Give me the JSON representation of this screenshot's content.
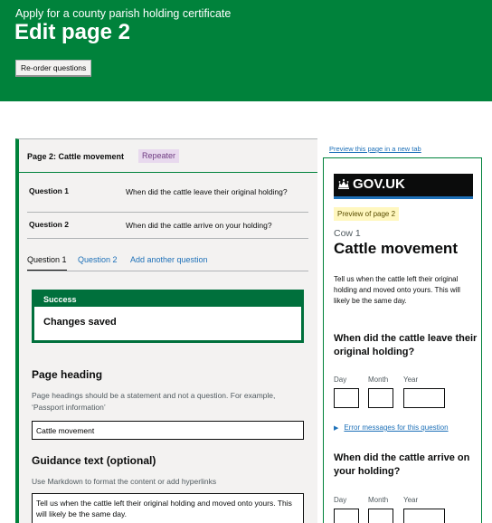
{
  "header": {
    "service_name": "Apply for a county parish holding certificate",
    "page_title": "Edit page 2",
    "reorder_label": "Re-order questions"
  },
  "editor": {
    "page_title": "Page 2: Cattle movement",
    "tag": "Repeater",
    "questions": [
      {
        "num": "Question 1",
        "text": "When did the cattle leave their original holding?"
      },
      {
        "num": "Question 2",
        "text": "When did the cattle arrive on your holding?"
      }
    ],
    "tabs": [
      "Question 1",
      "Question 2",
      "Add another question"
    ],
    "success": {
      "heading": "Success",
      "body": "Changes saved"
    },
    "page_heading": {
      "label": "Page heading",
      "hint": "Page headings should be a statement and not a question. For example, ‘Passport information’",
      "value": "Cattle movement"
    },
    "guidance": {
      "label": "Guidance text (optional)",
      "hint": "Use Markdown to format the content or add hyperlinks",
      "value": "Tell us when the cattle left their original holding and moved onto yours. This will likely be the same day."
    }
  },
  "preview": {
    "link": "Preview this page in a new tab",
    "brand": "GOV.UK",
    "tag": "Preview of page 2",
    "caption": "Cow 1",
    "heading": "Cattle movement",
    "body": "Tell us when the cattle left their original holding and moved onto yours. This will likely be the same day.",
    "q1": "When did the cattle leave their original holding?",
    "q2": "When did the cattle arrive on your holding?",
    "date_labels": {
      "day": "Day",
      "month": "Month",
      "year": "Year"
    },
    "details_link": "Error messages for this question"
  }
}
